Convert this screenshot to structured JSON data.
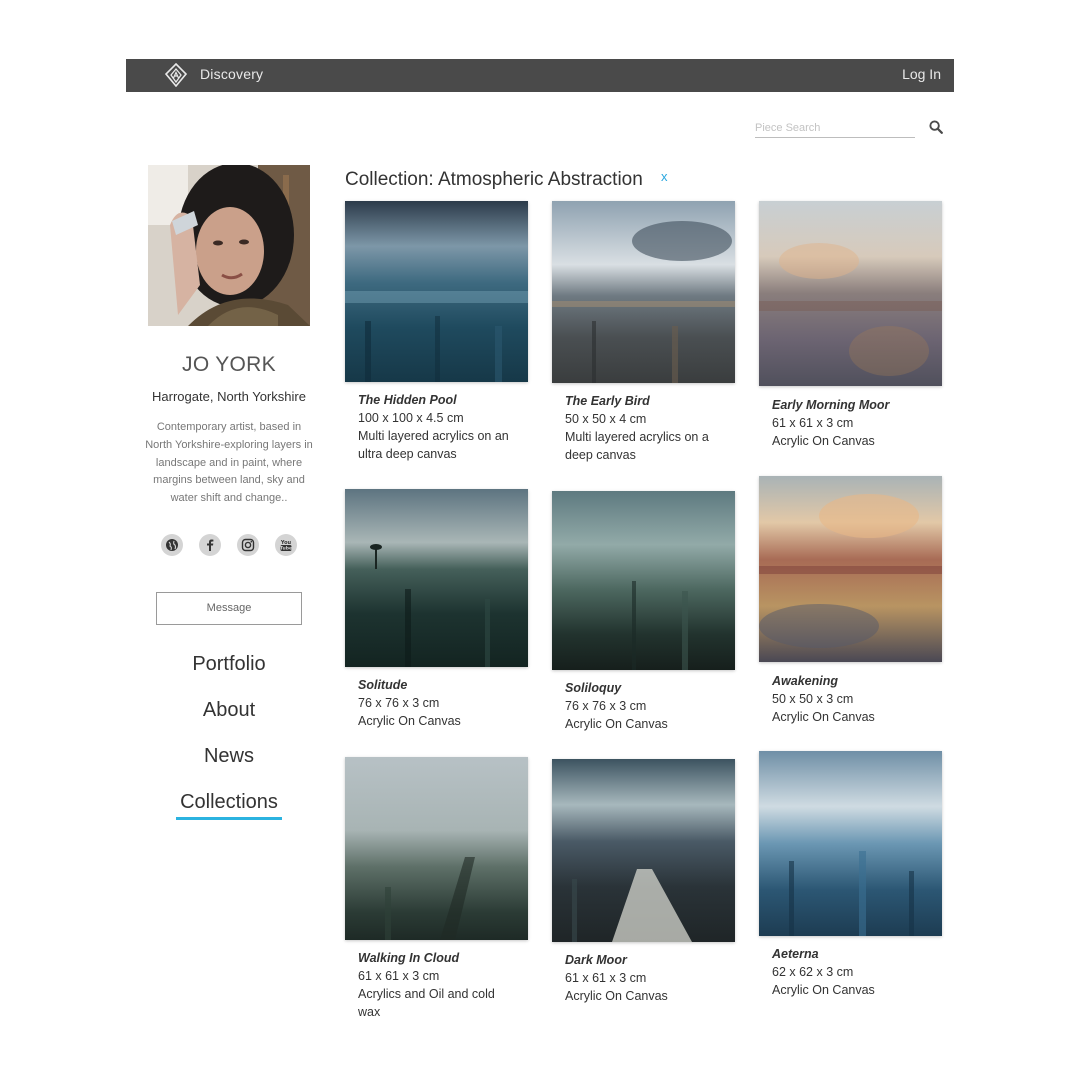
{
  "topbar": {
    "title": "Discovery",
    "login_label": "Log In"
  },
  "search": {
    "placeholder": "Piece Search",
    "value": ""
  },
  "artist": {
    "name": "JO YORK",
    "location": "Harrogate, North Yorkshire",
    "bio": "Contemporary artist, based in North Yorkshire-exploring layers in landscape and in paint, where margins between land, sky and water shift and change..",
    "social_icons": [
      "globe-icon",
      "facebook-icon",
      "instagram-icon",
      "youtube-icon"
    ],
    "message_label": "Message"
  },
  "nav": {
    "items": [
      "Portfolio",
      "About",
      "News",
      "Collections"
    ],
    "active": "Collections",
    "accent": "#2bb3e0"
  },
  "collection": {
    "title": "Collection: Atmospheric Abstraction",
    "clear_label": "x"
  },
  "artworks": [
    {
      "title": "The Hidden Pool",
      "size": "100 x 100 x 4.5 cm",
      "medium_lines": [
        "Multi layered acrylics on an",
        "ultra deep canvas"
      ]
    },
    {
      "title": "The Early Bird",
      "size": "50 x 50 x 4 cm",
      "medium_lines": [
        "Multi layered acrylics on a",
        "deep canvas"
      ]
    },
    {
      "title": "Early Morning Moor",
      "size": "61 x 61 x 3 cm",
      "medium_lines": [
        "Acrylic On Canvas"
      ]
    },
    {
      "title": "Solitude",
      "size": "76 x 76 x 3 cm",
      "medium_lines": [
        "Acrylic On Canvas"
      ]
    },
    {
      "title": "Soliloquy",
      "size": "76 x 76 x 3 cm",
      "medium_lines": [
        "Acrylic On Canvas"
      ]
    },
    {
      "title": "Awakening",
      "size": "50 x 50 x 3 cm",
      "medium_lines": [
        "Acrylic On Canvas"
      ]
    },
    {
      "title": "Walking In Cloud",
      "size": "61 x 61 x 3 cm",
      "medium_lines": [
        "Acrylics and Oil and cold",
        "wax"
      ]
    },
    {
      "title": "Dark Moor",
      "size": "61 x 61 x 3 cm",
      "medium_lines": [
        "Acrylic On Canvas"
      ]
    },
    {
      "title": "Aeterna",
      "size": "62 x 62 x 3 cm",
      "medium_lines": [
        "Acrylic On Canvas"
      ]
    }
  ]
}
